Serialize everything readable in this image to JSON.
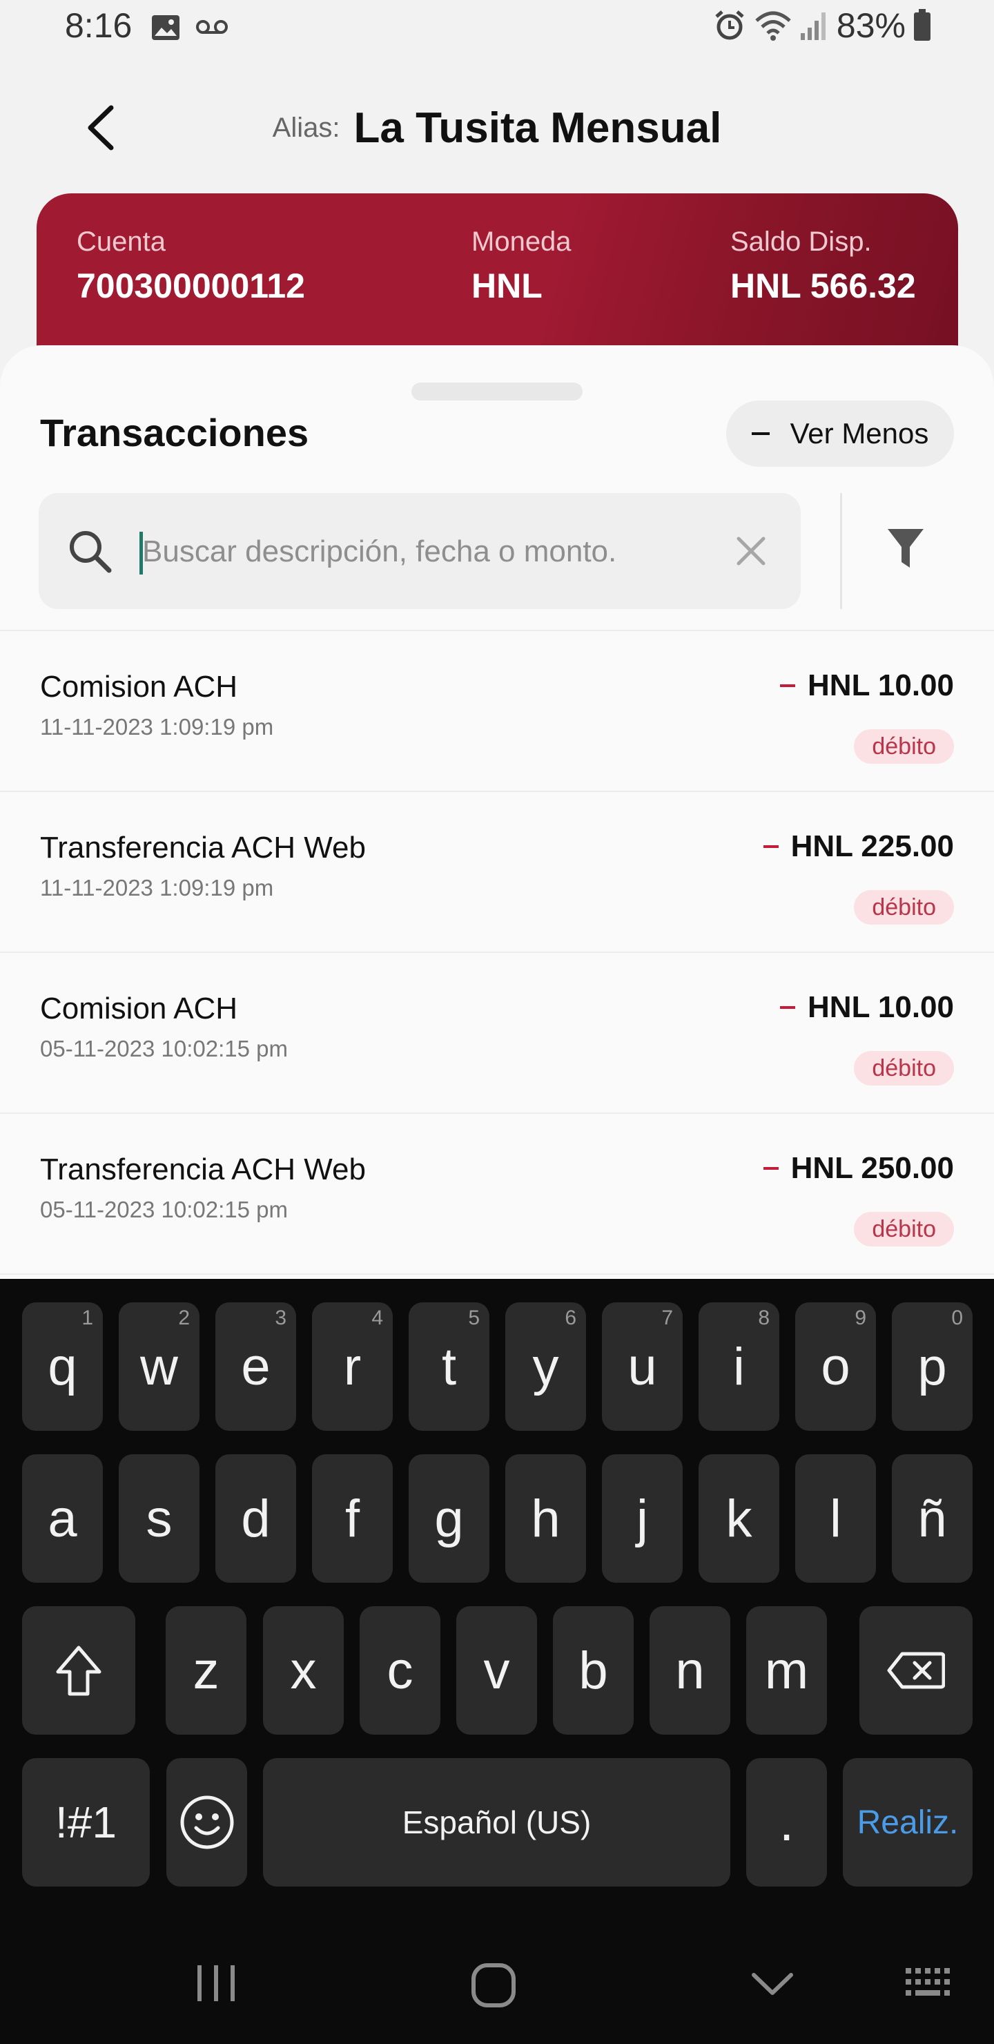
{
  "status": {
    "time": "8:16",
    "battery": "83%"
  },
  "header": {
    "alias_label": "Alias:",
    "alias_name": "La Tusita Mensual"
  },
  "account": {
    "cuenta_label": "Cuenta",
    "cuenta_value": "700300000112",
    "moneda_label": "Moneda",
    "moneda_value": "HNL",
    "saldo_label": "Saldo Disp.",
    "saldo_value": "HNL 566.32"
  },
  "transactions": {
    "title": "Transacciones",
    "toggle_label": "Ver Menos",
    "search_placeholder": "Buscar descripción, fecha o monto.",
    "items": [
      {
        "description": "Comision ACH",
        "date": "11-11-2023 1:09:19 pm",
        "amount": "HNL 10.00",
        "type": "débito"
      },
      {
        "description": "Transferencia ACH Web",
        "date": "11-11-2023 1:09:19 pm",
        "amount": "HNL 225.00",
        "type": "débito"
      },
      {
        "description": "Comision ACH",
        "date": "05-11-2023 10:02:15 pm",
        "amount": "HNL 10.00",
        "type": "débito"
      },
      {
        "description": "Transferencia ACH Web",
        "date": "05-11-2023 10:02:15 pm",
        "amount": "HNL 250.00",
        "type": "débito"
      }
    ]
  },
  "keyboard": {
    "row1": [
      {
        "key": "q",
        "num": "1"
      },
      {
        "key": "w",
        "num": "2"
      },
      {
        "key": "e",
        "num": "3"
      },
      {
        "key": "r",
        "num": "4"
      },
      {
        "key": "t",
        "num": "5"
      },
      {
        "key": "y",
        "num": "6"
      },
      {
        "key": "u",
        "num": "7"
      },
      {
        "key": "i",
        "num": "8"
      },
      {
        "key": "o",
        "num": "9"
      },
      {
        "key": "p",
        "num": "0"
      }
    ],
    "row2": [
      "a",
      "s",
      "d",
      "f",
      "g",
      "h",
      "j",
      "k",
      "l",
      "ñ"
    ],
    "row3": [
      "z",
      "x",
      "c",
      "v",
      "b",
      "n",
      "m"
    ],
    "symbols_label": "!#1",
    "space_label": "Español (US)",
    "period_label": ".",
    "done_label": "Realiz."
  },
  "colors": {
    "brand": "#a01a32",
    "debit_badge_bg": "#fbe0e4",
    "debit_text": "#b8354a",
    "done_blue": "#4a9ce8"
  },
  "icons": [
    "back-arrow-icon",
    "search-icon",
    "clear-icon",
    "filter-icon",
    "shift-icon",
    "backspace-icon",
    "emoji-icon",
    "recents-icon",
    "home-icon",
    "back-nav-icon",
    "keyboard-icon",
    "alarm-icon",
    "wifi-icon",
    "signal-icon",
    "battery-icon",
    "image-icon",
    "voicemail-icon"
  ]
}
